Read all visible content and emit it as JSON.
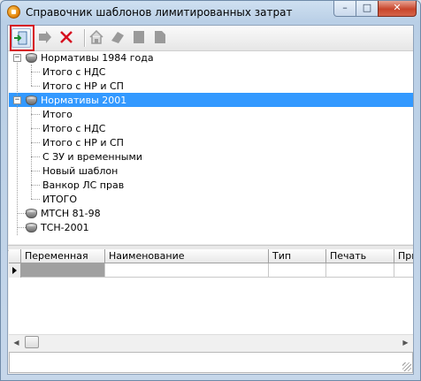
{
  "window": {
    "title": "Справочник шаблонов лимитированных затрат",
    "minimize_glyph": "–",
    "maximize_glyph": "□",
    "close_glyph": "✕"
  },
  "toolbar": {
    "buttons": [
      {
        "icon": "open-template-icon",
        "state": "enabled",
        "highlighted": true
      },
      {
        "icon": "move-forward-icon",
        "state": "disabled"
      },
      {
        "icon": "delete-icon",
        "state": "enabled",
        "color": "#d6101f"
      },
      {
        "icon": "home-icon",
        "state": "disabled"
      },
      {
        "icon": "eraser-icon",
        "state": "disabled"
      },
      {
        "icon": "page-icon",
        "state": "disabled"
      },
      {
        "icon": "page-folded-icon",
        "state": "disabled"
      }
    ]
  },
  "tree": {
    "nodes": [
      {
        "label": "Нормативы 1984 года",
        "expanded": true,
        "children": [
          "Итого с НДС",
          "Итого с НР и СП"
        ]
      },
      {
        "label": "Нормативы 2001",
        "expanded": true,
        "selected": true,
        "children": [
          "Итого",
          "Итого с НДС",
          "Итого с НР и СП",
          "С ЗУ и временными",
          "Новый шаблон",
          "Ванкор ЛС прав",
          "ИТОГО"
        ]
      },
      {
        "label": "МТСН 81-98",
        "expanded": false,
        "children": []
      },
      {
        "label": "ТСН-2001",
        "expanded": false,
        "children": []
      }
    ],
    "selection_color": "#3399ff"
  },
  "grid": {
    "columns": [
      "Переменная",
      "Наименование",
      "Тип",
      "Печать",
      "При"
    ],
    "rows": [
      [
        "",
        "",
        "",
        "",
        ""
      ]
    ]
  },
  "scrollbar": {
    "left_glyph": "◀",
    "right_glyph": "▶"
  }
}
